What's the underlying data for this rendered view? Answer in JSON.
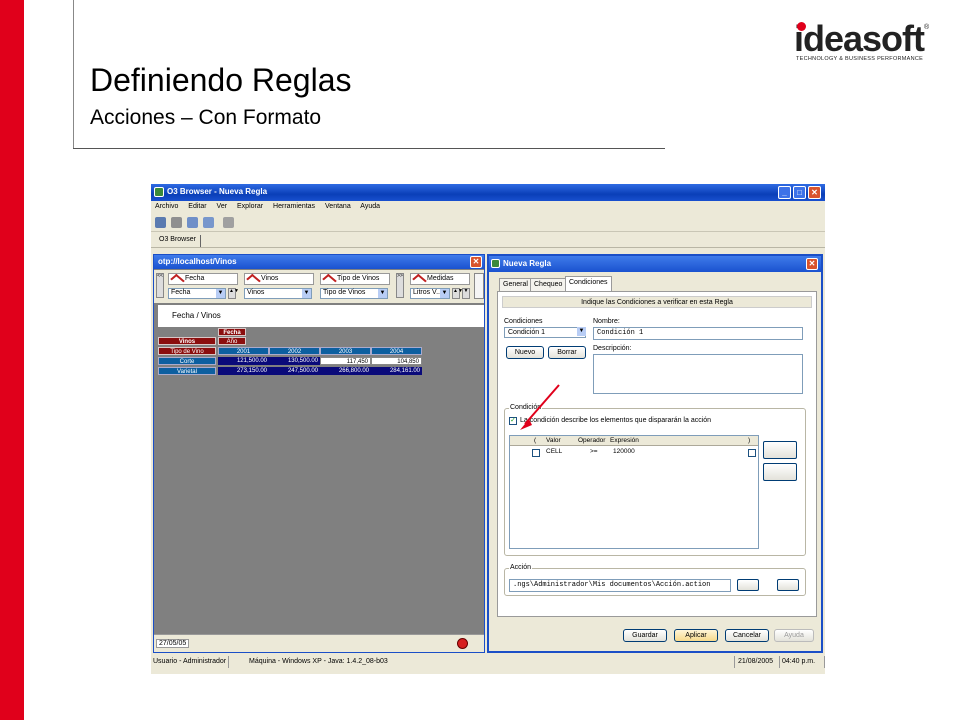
{
  "slide": {
    "title": "Definiendo Reglas",
    "subtitle": "Acciones – Con Formato",
    "logo_text": "ideasoft",
    "logo_tagline": "TECHNOLOGY & BUSINESS PERFORMANCE",
    "logo_reg": "®",
    "accent_color": "#e0001b"
  },
  "app": {
    "title": "O3 Browser - Nueva Regla",
    "menu": [
      "Archivo",
      "Editar",
      "Ver",
      "Explorar",
      "Herramientas",
      "Ventana",
      "Ayuda"
    ],
    "tab": "O3 Browser",
    "window_buttons": [
      "_",
      "□",
      "✕"
    ]
  },
  "cube_window": {
    "title": "otp://localhost/Vinos",
    "dimensions": [
      {
        "label": "Fecha",
        "value": "Fecha"
      },
      {
        "label": "Vinos",
        "value": "Vinos"
      },
      {
        "label": "Tipo de Vinos",
        "value": "Tipo de Vinos"
      },
      {
        "label": "Medidas",
        "value": "Litros V..."
      }
    ],
    "pager_left": "<<",
    "pager_right": ">>",
    "breadcrumb": "Fecha / Vinos",
    "table": {
      "col_dim": "Fecha",
      "col_level": "Año",
      "row_dim": "Vinos",
      "row_level": "Tipo de Vino",
      "years": [
        "2001",
        "2002",
        "2003",
        "2004"
      ],
      "rows": [
        {
          "label": "Corte",
          "values": [
            "121,500.00",
            "130,500.00",
            "117,450",
            "104,850"
          ]
        },
        {
          "label": "Varietal",
          "values": [
            "273,150.00",
            "247,500.00",
            "266,800.00",
            "284,161.00"
          ]
        }
      ]
    },
    "status_date": "27/05/05"
  },
  "rule_dialog": {
    "title": "Nueva Regla",
    "tabs": [
      "General",
      "Chequeo",
      "Condiciones"
    ],
    "active_tab": "Condiciones",
    "header": "Indique las Condiciones a verificar en esta Regla",
    "conditions_label": "Condiciones",
    "conditions_value": "Condición 1",
    "name_label": "Nombre:",
    "name_value": "Condición 1",
    "new_button": "Nuevo",
    "delete_button": "Borrar",
    "description_label": "Descripción:",
    "condition_group": "Condición",
    "condition_check_label": "La condición describe los elementos que dispararán la acción",
    "grid_headers": [
      "(",
      "Valor",
      "Operador",
      "Expresión",
      ")"
    ],
    "grid_row": {
      "value": "CELL",
      "operator": ">=",
      "expression": "120000"
    },
    "action_group": "Acción",
    "action_path": ".ngs\\Administrador\\Mis documentos\\Acción.action",
    "buttons": {
      "save": "Guardar",
      "apply": "Aplicar",
      "cancel": "Cancelar",
      "help": "Ayuda"
    }
  },
  "status_bar": {
    "user": "Usuario - Administrador",
    "machine": "Máquina - Windows XP - Java: 1.4.2_08-b03",
    "date": "21/08/2005",
    "time": "04:40 p.m."
  }
}
